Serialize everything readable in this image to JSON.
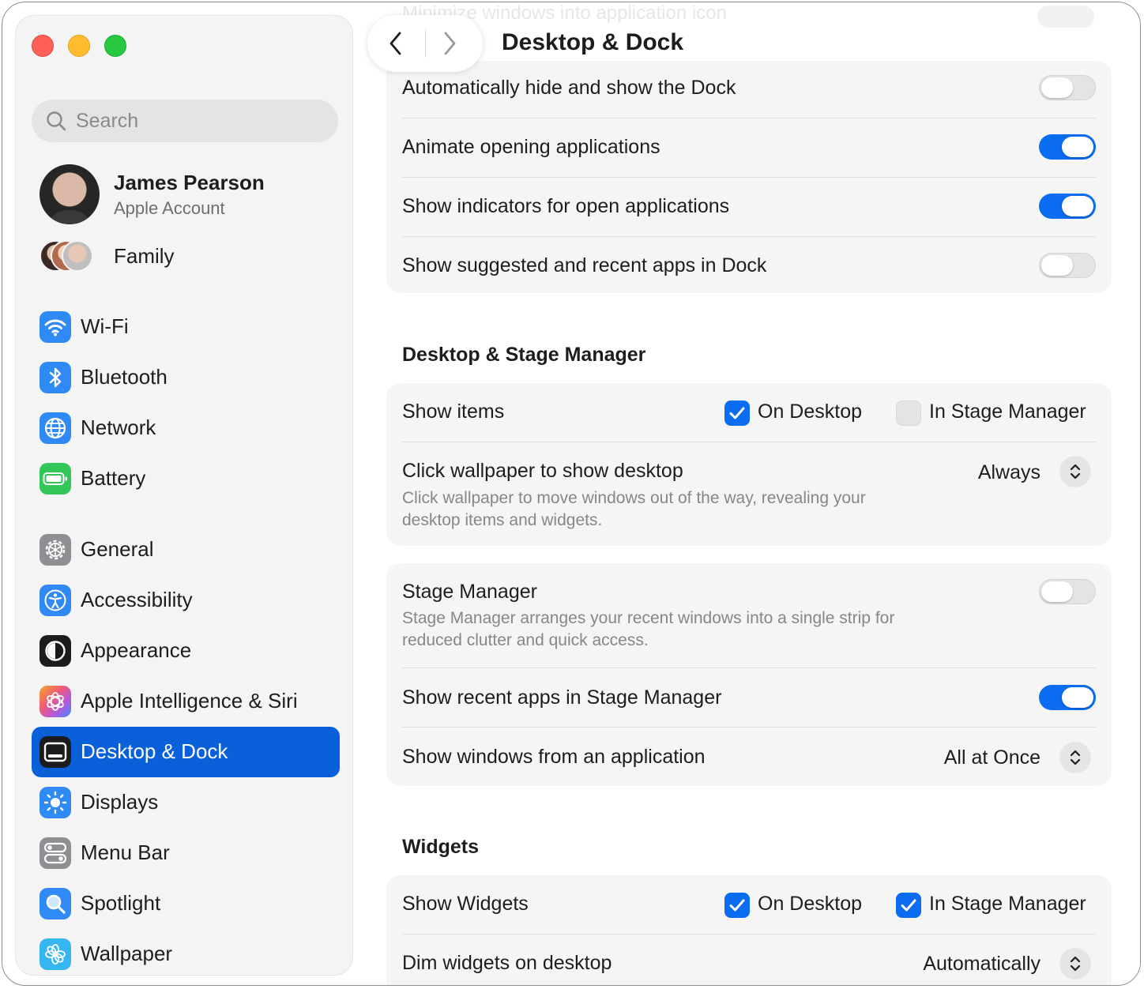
{
  "window": {
    "title": "Desktop & Dock",
    "traffic_lights": {
      "close_color": "#fe5f57",
      "minimize_color": "#febc2e",
      "zoom_color": "#28c840"
    }
  },
  "sidebar": {
    "search_placeholder": "Search",
    "account": {
      "name": "James Pearson",
      "subtitle": "Apple Account"
    },
    "family_label": "Family",
    "items": [
      {
        "label": "Wi-Fi",
        "icon": "wifi-icon",
        "color": "#2f8af5"
      },
      {
        "label": "Bluetooth",
        "icon": "bluetooth-icon",
        "color": "#2f8af5"
      },
      {
        "label": "Network",
        "icon": "globe-icon",
        "color": "#2f8af5"
      },
      {
        "label": "Battery",
        "icon": "battery-icon",
        "color": "#33c759"
      },
      {
        "label": "General",
        "icon": "gear-icon",
        "color": "#8e8e93"
      },
      {
        "label": "Accessibility",
        "icon": "accessibility-icon",
        "color": "#2f8af5"
      },
      {
        "label": "Appearance",
        "icon": "appearance-icon",
        "color": "#1c1c1e"
      },
      {
        "label": "Apple Intelligence & Siri",
        "icon": "siri-icon",
        "color": "#c45dd8"
      },
      {
        "label": "Desktop & Dock",
        "icon": "dock-icon",
        "color": "#1c1c1e",
        "selected": true
      },
      {
        "label": "Displays",
        "icon": "sun-icon",
        "color": "#2f8af5"
      },
      {
        "label": "Menu Bar",
        "icon": "menubar-icon",
        "color": "#8e8e93"
      },
      {
        "label": "Spotlight",
        "icon": "spotlight-icon",
        "color": "#2f8af5"
      },
      {
        "label": "Wallpaper",
        "icon": "wallpaper-icon",
        "color": "#36b6f0"
      }
    ],
    "selected_color": "#0a60d9"
  },
  "content": {
    "ghost_row": "Minimize windows into application icon",
    "dock": {
      "rows": [
        {
          "label": "Automatically hide and show the Dock",
          "toggle": false
        },
        {
          "label": "Animate opening applications",
          "toggle": true
        },
        {
          "label": "Show indicators for open applications",
          "toggle": true
        },
        {
          "label": "Show suggested and recent apps in Dock",
          "toggle": false
        }
      ]
    },
    "desktop_stage": {
      "title": "Desktop & Stage Manager",
      "show_items": {
        "label": "Show items",
        "on_desktop": {
          "label": "On Desktop",
          "checked": true
        },
        "in_stage_manager": {
          "label": "In Stage Manager",
          "checked": false
        }
      },
      "click_wallpaper": {
        "label": "Click wallpaper to show desktop",
        "subtitle_line1": "Click wallpaper to move windows out of the way, revealing your",
        "subtitle_line2": "desktop items and widgets.",
        "value": "Always"
      },
      "stage_manager": {
        "label": "Stage Manager",
        "subtitle_line1": "Stage Manager arranges your recent windows into a single strip for",
        "subtitle_line2": "reduced clutter and quick access.",
        "toggle": false
      },
      "show_recent_apps": {
        "label": "Show recent apps in Stage Manager",
        "toggle": true
      },
      "show_windows": {
        "label": "Show windows from an application",
        "value": "All at Once"
      }
    },
    "widgets": {
      "title": "Widgets",
      "show_widgets": {
        "label": "Show Widgets",
        "on_desktop": {
          "label": "On Desktop",
          "checked": true
        },
        "in_stage_manager": {
          "label": "In Stage Manager",
          "checked": true
        }
      },
      "dim_widgets": {
        "label": "Dim widgets on desktop",
        "value": "Automatically"
      }
    },
    "accent_color": "#0a6cf0"
  }
}
